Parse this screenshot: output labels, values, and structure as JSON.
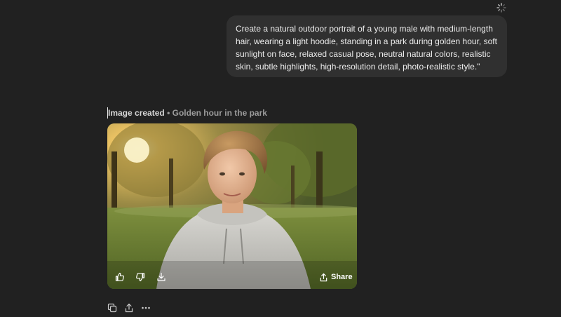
{
  "user_message": {
    "text": "Create a natural outdoor portrait of a young male with medium-length hair, wearing a light hoodie, standing in a park during golden hour, soft sunlight on face, relaxed casual pose, neutral natural colors, realistic skin, subtle highlights, high-resolution detail, photo-realistic style.\""
  },
  "image_result": {
    "status": "Image created",
    "separator": "•",
    "caption": "Golden hour in the park",
    "share_label": "Share"
  },
  "icons": {
    "status": "spinner-icon",
    "overlay": [
      "thumbs-up-icon",
      "thumbs-down-icon",
      "download-icon",
      "share-icon"
    ],
    "actions": [
      "copy-icon",
      "share-icon",
      "more-icon"
    ]
  },
  "colors": {
    "background": "#212121",
    "bubble": "#303030",
    "text": "#ececec",
    "muted": "#9b9b9b"
  }
}
